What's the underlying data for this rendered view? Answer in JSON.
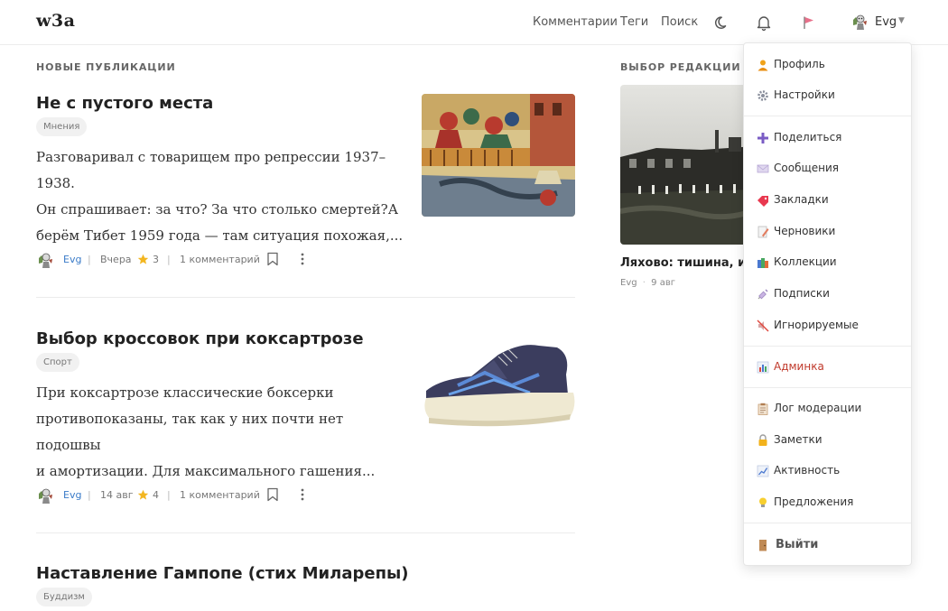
{
  "header": {
    "logo": "w3a",
    "nav": {
      "comments": "Комментарии",
      "tags": "Теги",
      "search": "Поиск"
    },
    "user": {
      "name": "Evg"
    }
  },
  "feed": {
    "section_title": "НОВЫЕ ПУБЛИКАЦИИ",
    "posts": [
      {
        "title": "Не с пустого места",
        "tag": "Мнения",
        "excerpt": [
          "Разговаривал с товарищем про репрессии 1937–1938.",
          "Он спрашивает: за что? За что столько смертей?А",
          "берём Тибет 1959 года — там ситуация похожая,..."
        ],
        "author": "Evg",
        "date": "Вчера",
        "stars": "3",
        "comments": "1 комментарий"
      },
      {
        "title": "Выбор кроссовок при коксартрозе",
        "tag": "Спорт",
        "excerpt": [
          "При коксартрозе классические боксерки",
          "противопоказаны, так как у них почти нет подошвы",
          "и амортизации. Для максимального гашения..."
        ],
        "author": "Evg",
        "date": "14 авг",
        "stars": "4",
        "comments": "1 комментарий"
      },
      {
        "title": "Наставление Гампопе (стих Миларепы)",
        "tag": "Буддизм"
      }
    ]
  },
  "editors": {
    "section_title": "ВЫБОР РЕДАКЦИИ",
    "item": {
      "title": "Ляхово: тишина, исто",
      "author": "Evg",
      "dot": "·",
      "date": "9 авг"
    }
  },
  "menu": {
    "items": [
      {
        "label": "Профиль",
        "icon": "person-icon"
      },
      {
        "label": "Настройки",
        "icon": "gear-icon"
      },
      {
        "label": "Поделиться",
        "icon": "plus-icon"
      },
      {
        "label": "Сообщения",
        "icon": "envelope-icon"
      },
      {
        "label": "Закладки",
        "icon": "bookmark-tag-icon"
      },
      {
        "label": "Черновики",
        "icon": "memo-icon"
      },
      {
        "label": "Коллекции",
        "icon": "books-icon"
      },
      {
        "label": "Подписки",
        "icon": "syringe-icon"
      },
      {
        "label": "Игнорируемые",
        "icon": "muted-icon"
      },
      {
        "label": "Админка",
        "icon": "bar-chart-icon"
      },
      {
        "label": "Лог модерации",
        "icon": "clipboard-icon"
      },
      {
        "label": "Заметки",
        "icon": "lock-icon"
      },
      {
        "label": "Активность",
        "icon": "line-chart-icon"
      },
      {
        "label": "Предложения",
        "icon": "bulb-icon"
      },
      {
        "label": "Выйти",
        "icon": "door-icon"
      }
    ]
  },
  "colors": {
    "link": "#3a7bc8",
    "admin": "#c0392b",
    "star": "#f3b620",
    "flag": "#e8708a"
  }
}
